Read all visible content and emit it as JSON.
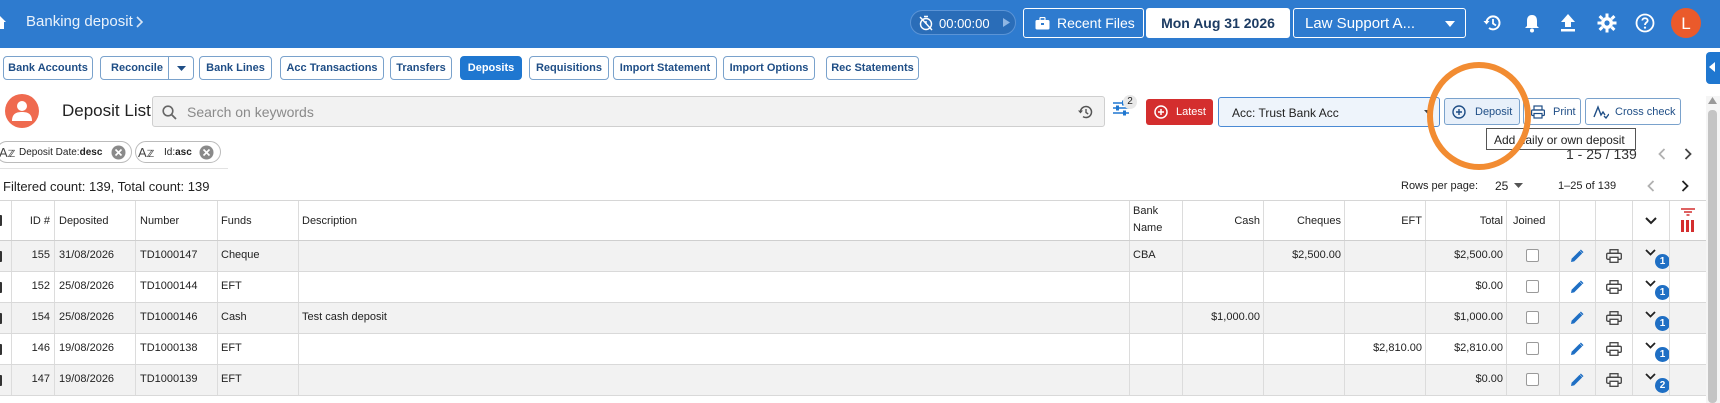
{
  "topbar": {
    "breadcrumb": "Banking deposit",
    "timer": "00:00:00",
    "recent_files": "Recent Files",
    "date": "Mon Aug 31 2026",
    "law_support": "Law Support A...",
    "avatar_letter": "L",
    "bar_color": "#2e7bcf"
  },
  "nav": {
    "tabs": [
      {
        "label": "Bank Accounts"
      },
      {
        "label": "Reconcile"
      },
      {
        "label": "Bank Lines"
      },
      {
        "label": "Acc Transactions"
      },
      {
        "label": "Transfers"
      },
      {
        "label": "Deposits",
        "active": true
      },
      {
        "label": "Requisitions"
      },
      {
        "label": "Import Statement"
      },
      {
        "label": "Import Options"
      },
      {
        "label": "Rec Statements"
      }
    ]
  },
  "list": {
    "title": "Deposit List",
    "search_placeholder": "Search on keywords",
    "filter_count": "2",
    "latest_label": "Latest",
    "account_label": "Acc:  Trust Bank Acc",
    "deposit_button": "Deposit",
    "print_button": "Print",
    "cross_check_button": "Cross check",
    "tooltip": "Add daily or own deposit"
  },
  "sort_chips": [
    {
      "prefix": "Deposit Date:",
      "dir": "desc"
    },
    {
      "prefix": "Id:",
      "dir": "asc"
    }
  ],
  "pagination": {
    "range_top": "1 - 25 / 139",
    "counts": "Filtered count: 139, Total count: 139",
    "rows_per_page_label": "Rows per page:",
    "rows_per_page": "25",
    "range_bottom": "1–25 of 139"
  },
  "table": {
    "columns": {
      "id": "ID #",
      "deposited": "Deposited",
      "number": "Number",
      "funds": "Funds",
      "description": "Description",
      "bank_name_1": "Bank",
      "bank_name_2": "Name",
      "cash": "Cash",
      "cheques": "Cheques",
      "eft": "EFT",
      "total": "Total",
      "joined": "Joined"
    },
    "rows": [
      {
        "id": "155",
        "deposited": "31/08/2026",
        "number": "TD1000147",
        "funds": "Cheque",
        "description": "",
        "bank": "CBA",
        "cash": "",
        "cheques": "$2,500.00",
        "eft": "",
        "total": "$2,500.00",
        "badge": "1"
      },
      {
        "id": "152",
        "deposited": "25/08/2026",
        "number": "TD1000144",
        "funds": "EFT",
        "description": "",
        "bank": "",
        "cash": "",
        "cheques": "",
        "eft": "",
        "total": "$0.00",
        "badge": "1"
      },
      {
        "id": "154",
        "deposited": "25/08/2026",
        "number": "TD1000146",
        "funds": "Cash",
        "description": "Test cash deposit",
        "bank": "",
        "cash": "$1,000.00",
        "cheques": "",
        "eft": "",
        "total": "$1,000.00",
        "badge": "1"
      },
      {
        "id": "146",
        "deposited": "19/08/2026",
        "number": "TD1000138",
        "funds": "EFT",
        "description": "",
        "bank": "",
        "cash": "",
        "cheques": "",
        "eft": "$2,810.00",
        "total": "$2,810.00",
        "badge": "1"
      },
      {
        "id": "147",
        "deposited": "19/08/2026",
        "number": "TD1000139",
        "funds": "EFT",
        "description": "",
        "bank": "",
        "cash": "",
        "cheques": "",
        "eft": "",
        "total": "$0.00",
        "badge": "2"
      }
    ]
  },
  "icons": {
    "home": "home-icon",
    "history": "history-icon",
    "bell": "bell-icon",
    "upload": "upload-icon",
    "settings": "gear-icon",
    "help": "help-icon",
    "search": "search-icon",
    "filter": "filter-settings-icon",
    "edit": "pencil-icon",
    "print": "printer-icon",
    "expand": "chevron-down-icon"
  },
  "colors": {
    "accent": "#1f77d0",
    "latest": "#d42e2e",
    "avatar": "#ea5a2b",
    "badge": "#1f6fc4",
    "highlight": "#f28c32"
  }
}
